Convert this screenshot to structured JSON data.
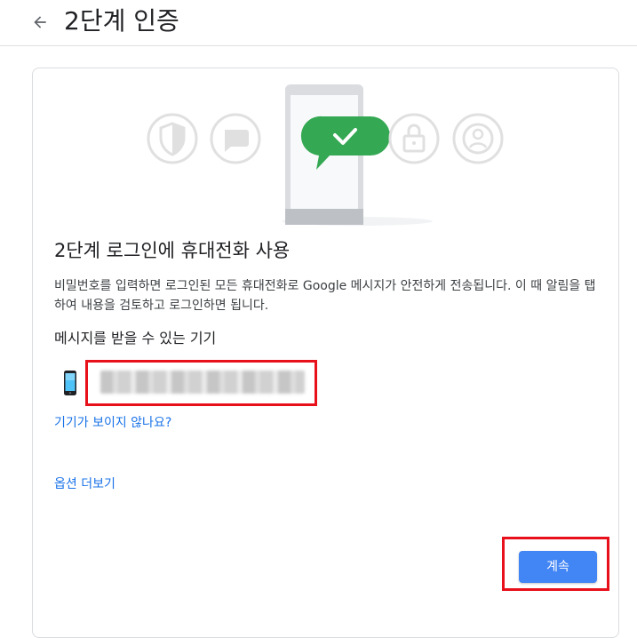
{
  "header": {
    "back_icon": "arrow-back-icon",
    "title": "2단계 인증"
  },
  "card": {
    "illustration": {
      "icons": [
        "shield-icon",
        "chat-bubble-icon",
        "phone-checkmark-icon",
        "lock-icon",
        "account-icon"
      ],
      "accent_color": "#34a853"
    },
    "heading": "2단계 로그인에 휴대전화 사용",
    "description": "비밀번호를 입력하면 로그인된 모든 휴대전화로 Google 메시지가 안전하게 전송됩니다. 이 때 알림을 탭하여 내용을 검토하고 로그인하면 됩니다.",
    "devices_heading": "메시지를 받을 수 있는 기기",
    "device": {
      "icon": "smartphone-icon",
      "name": "████████ ████ ██████"
    },
    "missing_device_link": "기기가 보이지 않나요?",
    "more_options_link": "옵션 더보기",
    "continue_button": "계속"
  },
  "colors": {
    "primary_button": "#4285f4",
    "link": "#1a73e8",
    "highlight": "#e8101a"
  }
}
